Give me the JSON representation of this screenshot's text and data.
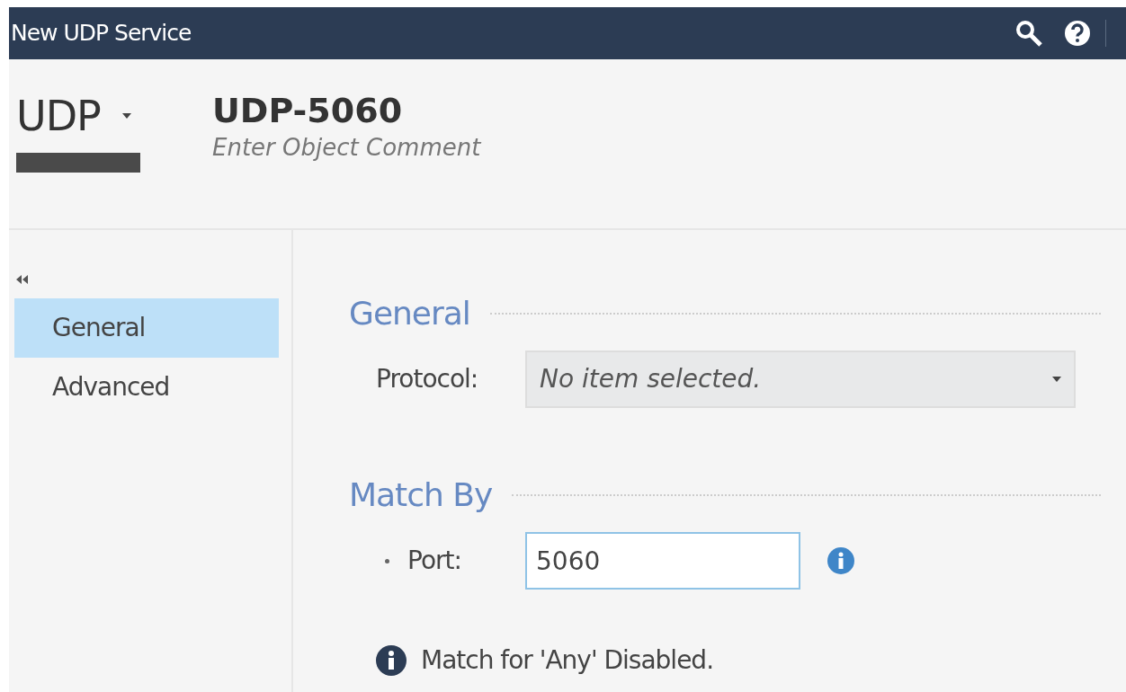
{
  "window": {
    "title": "New UDP Service"
  },
  "header": {
    "type_label": "UDP",
    "name": "UDP-5060",
    "comment_placeholder": "Enter Object Comment"
  },
  "sidebar": {
    "items": [
      {
        "label": "General",
        "selected": true
      },
      {
        "label": "Advanced",
        "selected": false
      }
    ]
  },
  "sections": [
    {
      "title": "General",
      "fields": [
        {
          "kind": "dropdown",
          "label": "Protocol:",
          "placeholder": "No item selected.",
          "required": false
        }
      ]
    },
    {
      "title": "Match By",
      "fields": [
        {
          "kind": "text",
          "label": "Port:",
          "value": "5060",
          "required": true
        }
      ]
    }
  ],
  "note": "Match for 'Any' Disabled."
}
